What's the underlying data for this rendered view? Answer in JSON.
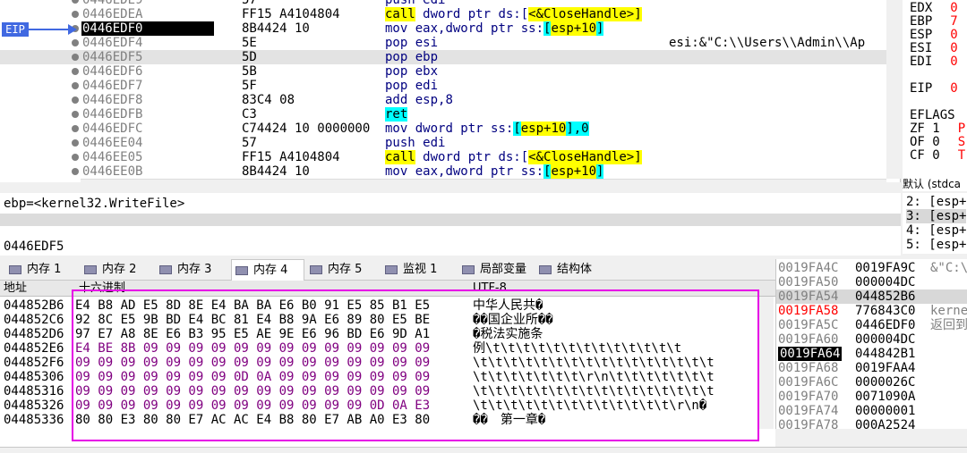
{
  "disasm": {
    "rows": [
      {
        "addr": "0446EDE9",
        "bytes": "57",
        "mn": "push",
        "ops": "edi"
      },
      {
        "addr": "0446EDEA",
        "bytes": "FF15 A4104804",
        "mn": "call",
        "ops_pre": "dword ptr ds:[",
        "ops_sym": "<&CloseHandle>",
        "ops_post": "]"
      },
      {
        "addr": "0446EDF0",
        "bytes": "8B4424 10",
        "mn": "mov",
        "ops_pre": "eax,dword ptr ss:",
        "ops_sym": "[",
        "ops_mid": "esp+10",
        "ops_post": "]"
      },
      {
        "addr": "0446EDF4",
        "bytes": "5E",
        "mn": "pop",
        "ops": "esi",
        "comment": "esi:&\"C:\\\\Users\\\\Admin\\\\Ap"
      },
      {
        "addr": "0446EDF5",
        "bytes": "5D",
        "mn": "pop",
        "ops": "ebp"
      },
      {
        "addr": "0446EDF6",
        "bytes": "5B",
        "mn": "pop",
        "ops": "ebx"
      },
      {
        "addr": "0446EDF7",
        "bytes": "5F",
        "mn": "pop",
        "ops": "edi"
      },
      {
        "addr": "0446EDF8",
        "bytes": "83C4 08",
        "mn": "add",
        "ops": "esp,8"
      },
      {
        "addr": "0446EDFB",
        "bytes": "C3",
        "mn": "ret",
        "ops": ""
      },
      {
        "addr": "0446EDFC",
        "bytes": "C74424 10 0000000",
        "mn": "mov",
        "ops_pre": "dword ptr ss:",
        "ops_sym": "[",
        "ops_mid": "esp+10",
        "ops_post": "],0"
      },
      {
        "addr": "0446EE04",
        "bytes": "57",
        "mn": "push",
        "ops": "edi"
      },
      {
        "addr": "0446EE05",
        "bytes": "FF15 A4104804",
        "mn": "call",
        "ops_pre": "dword ptr ds:[",
        "ops_sym": "<&CloseHandle>",
        "ops_post": "]"
      },
      {
        "addr": "0446EE0B",
        "bytes": "8B4424 10",
        "mn": "mov",
        "ops_pre": "eax,dword ptr ss:",
        "ops_sym": "[",
        "ops_mid": "esp+10",
        "ops_post": "]"
      }
    ],
    "eip_label": "EIP",
    "current_addr": "0446EDF0",
    "highlight_addr": "0446EDF5"
  },
  "registers": {
    "rows": [
      {
        "name": "EDX",
        "val": "0"
      },
      {
        "name": "EBP",
        "val": "7"
      },
      {
        "name": "ESP",
        "val": "0"
      },
      {
        "name": "ESI",
        "val": "0"
      },
      {
        "name": "EDI",
        "val": "0"
      },
      {
        "name": "EIP",
        "val": "0"
      },
      {
        "name": "EFLAGS",
        "val": ""
      },
      {
        "name": "ZF 1",
        "val": "P"
      },
      {
        "name": "OF 0",
        "val": "S"
      },
      {
        "name": "CF 0",
        "val": "T"
      }
    ],
    "callconv": "默认 (stdca",
    "args": [
      "2: [esp+",
      "3: [esp+",
      "4: [esp+",
      "5: [esp+"
    ]
  },
  "info": {
    "line1": "ebp=<kernel32.WriteFile>",
    "line2": "0446EDF5"
  },
  "tabs": [
    {
      "label": "内存 1"
    },
    {
      "label": "内存 2"
    },
    {
      "label": "内存 3"
    },
    {
      "label": "内存 4"
    },
    {
      "label": "内存 5"
    },
    {
      "label": "监视 1"
    },
    {
      "label": "局部变量"
    },
    {
      "label": "结构体"
    }
  ],
  "dump": {
    "header": {
      "addr": "地址",
      "hex": "十六进制",
      "text": "UTF-8"
    },
    "rows": [
      {
        "addr": "044852B6",
        "hex": "E4 B8 AD E5 8D 8E E4 BA BA E6 B0 91 E5 85 B1 E5",
        "text": "中华人民共�"
      },
      {
        "addr": "044852C6",
        "hex": "92 8C E5 9B BD E4 BC 81 E4 B8 9A E6 89 80 E5 BE",
        "text": "��国企业所��"
      },
      {
        "addr": "044852D6",
        "hex": "97 E7 A8 8E E6 B3 95 E5 AE 9E E6 96 BD E6 9D A1",
        "text": "�税法实施条"
      },
      {
        "addr": "044852E6",
        "hex": "E4 BE 8B 09 09 09 09 09 09 09 09 09 09 09 09 09",
        "text": "例\\t\\t\\t\\t\\t\\t\\t\\t\\t\\t\\t\\t\\t"
      },
      {
        "addr": "044852F6",
        "hex": "09 09 09 09 09 09 09 09 09 09 09 09 09 09 09 09",
        "text": "\\t\\t\\t\\t\\t\\t\\t\\t\\t\\t\\t\\t\\t\\t\\t\\t"
      },
      {
        "addr": "04485306",
        "hex": "09 09 09 09 09 09 09 0D 0A 09 09 09 09 09 09 09",
        "text": "\\t\\t\\t\\t\\t\\t\\t\\r\\n\\t\\t\\t\\t\\t\\t\\t"
      },
      {
        "addr": "04485316",
        "hex": "09 09 09 09 09 09 09 09 09 09 09 09 09 09 09 09",
        "text": "\\t\\t\\t\\t\\t\\t\\t\\t\\t\\t\\t\\t\\t\\t\\t\\t"
      },
      {
        "addr": "04485326",
        "hex": "09 09 09 09 09 09 09 09 09 09 09 09 09 0D 0A E3",
        "text": "\\t\\t\\t\\t\\t\\t\\t\\t\\t\\t\\t\\t\\t\\r\\n�"
      },
      {
        "addr": "04485336",
        "hex": "80 80 E3 80 80 E7 AC AC E4 B8 80 E7 AB A0 E3 80",
        "text": "��　第一章�"
      }
    ]
  },
  "stack": {
    "rows": [
      {
        "addr": "0019FA4C",
        "val": "0019FA9C",
        "cmt": "&\"C:\\"
      },
      {
        "addr": "0019FA50",
        "val": "000004DC",
        "cmt": ""
      },
      {
        "addr": "0019FA54",
        "val": "044852B6",
        "cmt": ""
      },
      {
        "addr": "0019FA58",
        "val": "776843C0",
        "cmt": "kerne"
      },
      {
        "addr": "0019FA5C",
        "val": "0446EDF0",
        "cmt": "返回到"
      },
      {
        "addr": "0019FA60",
        "val": "000004DC",
        "cmt": ""
      },
      {
        "addr": "0019FA64",
        "val": "044842B1",
        "cmt": ""
      },
      {
        "addr": "0019FA68",
        "val": "0019FAA4",
        "cmt": ""
      },
      {
        "addr": "0019FA6C",
        "val": "0000026C",
        "cmt": ""
      },
      {
        "addr": "0019FA70",
        "val": "0071090A",
        "cmt": ""
      },
      {
        "addr": "0019FA74",
        "val": "00000001",
        "cmt": ""
      },
      {
        "addr": "0019FA78",
        "val": "000A2524",
        "cmt": ""
      }
    ]
  },
  "colors": {
    "eip": "#4169e1",
    "highlight_box": "#e600e6",
    "call": "#ffff00",
    "ret": "#00ffff"
  }
}
